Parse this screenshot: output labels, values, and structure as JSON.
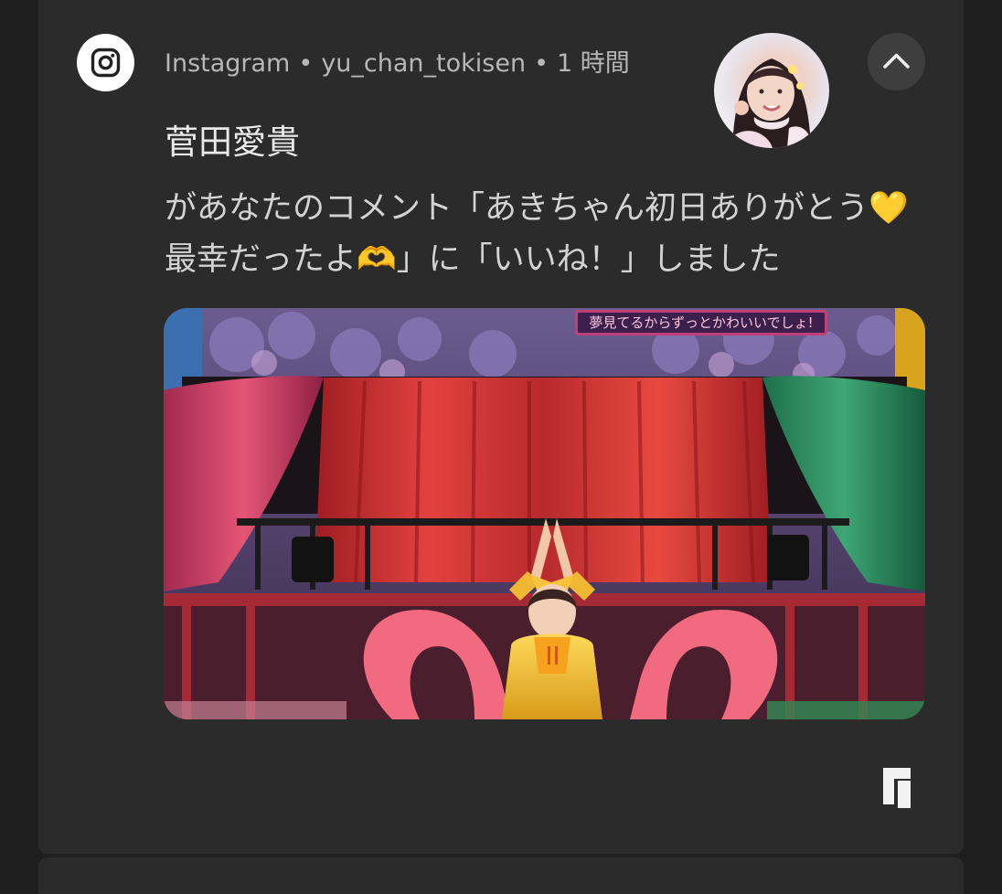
{
  "notification": {
    "app_name": "Instagram",
    "separator": "•",
    "account": "yu_chan_tokisen",
    "time_ago": "1 時間",
    "title": "菅田愛貴",
    "body": "があなたのコメント「あきちゃん初日ありがとう💛最幸だったよ🫶」に「いいね！」しました",
    "photo_caption": "夢見てるからずっとかわいいでしょ!",
    "icons": {
      "app": "instagram-icon",
      "collapse": "chevron-up-icon",
      "corner": "app-logo-icon"
    }
  },
  "colors": {
    "background": "#1f1f1f",
    "card": "#2b2b2b",
    "text_primary": "#eaeaea",
    "text_secondary": "#b7b7b7"
  }
}
